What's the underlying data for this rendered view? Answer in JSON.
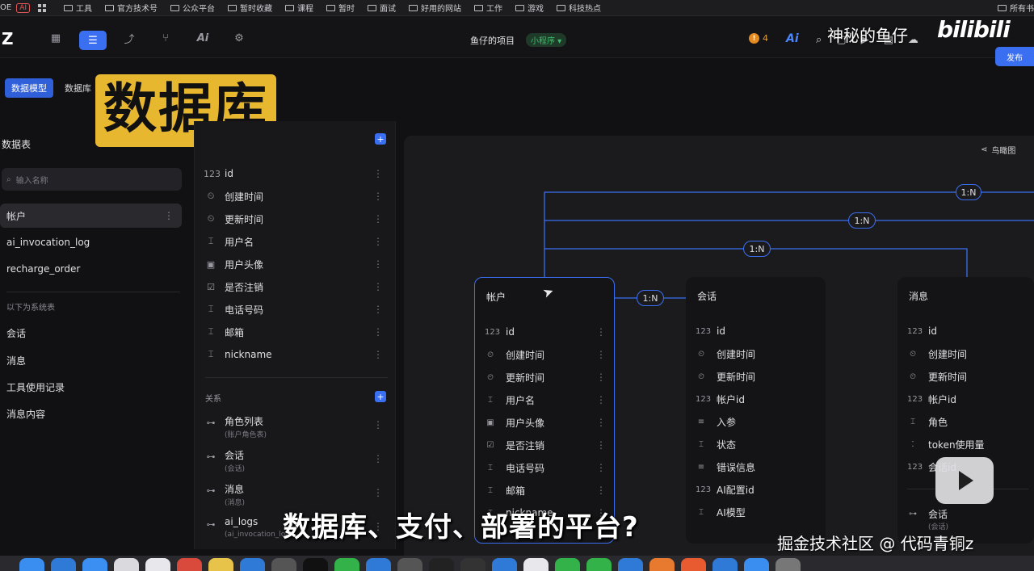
{
  "bookmarks": {
    "prefix": "OE",
    "ai_label": "AI",
    "items": [
      "工具",
      "官方技术号",
      "公众平台",
      "暂时收藏",
      "课程",
      "暂时",
      "面试",
      "好用的网站",
      "工作",
      "游戏",
      "科技热点"
    ],
    "all": "所有书"
  },
  "toolbar": {
    "logo": "Z",
    "project_title": "鱼仔的项目",
    "mini_badge": "小程序 ▾",
    "warn_count": "4",
    "warn_icon": "!",
    "ai_label": "Ai",
    "publish": "发布",
    "icons": [
      "page-icon",
      "database-icon",
      "workflow-icon",
      "logic-icon",
      "ai-icon",
      "settings-icon"
    ]
  },
  "overlay": {
    "uploader": "神秘的鱼仔",
    "site_logo": "bilibili",
    "big_title": "数据库",
    "subtitle": "数据库、支付、部署的平台?",
    "source": "掘金技术社区 @ 代码青铜z"
  },
  "tabs": [
    {
      "label": "数据模型",
      "active": true
    },
    {
      "label": "数据库",
      "active": false
    }
  ],
  "sidebar": {
    "title": "数据表",
    "search_placeholder": "输入名称",
    "tables": [
      "帐户",
      "ai_invocation_log",
      "recharge_order"
    ],
    "system_label": "以下为系统表",
    "system_tables": [
      "会话",
      "消息",
      "工具使用记录",
      "消息内容"
    ]
  },
  "fields_panel": {
    "fields": [
      {
        "icon": "123",
        "name": "id"
      },
      {
        "icon": "⏲",
        "name": "创建时间"
      },
      {
        "icon": "⏲",
        "name": "更新时间"
      },
      {
        "icon": "⌶",
        "name": "用户名"
      },
      {
        "icon": "▣",
        "name": "用户头像"
      },
      {
        "icon": "☑",
        "name": "是否注销"
      },
      {
        "icon": "⌶",
        "name": "电话号码"
      },
      {
        "icon": "⌶",
        "name": "邮箱"
      },
      {
        "icon": "⌶",
        "name": "nickname"
      }
    ],
    "relations_label": "关系",
    "relations": [
      {
        "name": "角色列表",
        "sub": "(账户角色表)"
      },
      {
        "name": "会话",
        "sub": "(会话)"
      },
      {
        "name": "消息",
        "sub": "(消息)"
      },
      {
        "name": "ai_logs",
        "sub": "(ai_invocation_log)"
      }
    ]
  },
  "canvas": {
    "bird_view": "鸟瞰图",
    "relations": [
      "1:N",
      "1:N",
      "1:N",
      "1:N"
    ],
    "cards": [
      {
        "title": "帐户",
        "rows": [
          {
            "icon": "123",
            "name": "id"
          },
          {
            "icon": "⏲",
            "name": "创建时间"
          },
          {
            "icon": "⏲",
            "name": "更新时间"
          },
          {
            "icon": "⌶",
            "name": "用户名"
          },
          {
            "icon": "▣",
            "name": "用户头像"
          },
          {
            "icon": "☑",
            "name": "是否注销"
          },
          {
            "icon": "⌶",
            "name": "电话号码"
          },
          {
            "icon": "⌶",
            "name": "邮箱"
          },
          {
            "icon": "⌶",
            "name": "nickname"
          }
        ]
      },
      {
        "title": "会话",
        "rows": [
          {
            "icon": "123",
            "name": "id"
          },
          {
            "icon": "⏲",
            "name": "创建时间"
          },
          {
            "icon": "⏲",
            "name": "更新时间"
          },
          {
            "icon": "123",
            "name": "帐户id"
          },
          {
            "icon": "≡",
            "name": "入参"
          },
          {
            "icon": "⌶",
            "name": "状态"
          },
          {
            "icon": "≡",
            "name": "错误信息"
          },
          {
            "icon": "123",
            "name": "AI配置id"
          },
          {
            "icon": "⌶",
            "name": "AI模型"
          }
        ]
      },
      {
        "title": "消息",
        "rows": [
          {
            "icon": "123",
            "name": "id"
          },
          {
            "icon": "⏲",
            "name": "创建时间"
          },
          {
            "icon": "⏲",
            "name": "更新时间"
          },
          {
            "icon": "123",
            "name": "帐户id"
          },
          {
            "icon": "⌶",
            "name": "角色"
          },
          {
            "icon": "⁚",
            "name": "token使用量"
          },
          {
            "icon": "123",
            "name": "会话id"
          }
        ],
        "relation": {
          "name": "会话",
          "sub": "(会话)"
        }
      }
    ]
  },
  "colors": {
    "accent": "#3b6ff2",
    "title_outline": "#e8b730",
    "badge_green": "#3fbf6e",
    "warn": "#e58a1f"
  }
}
